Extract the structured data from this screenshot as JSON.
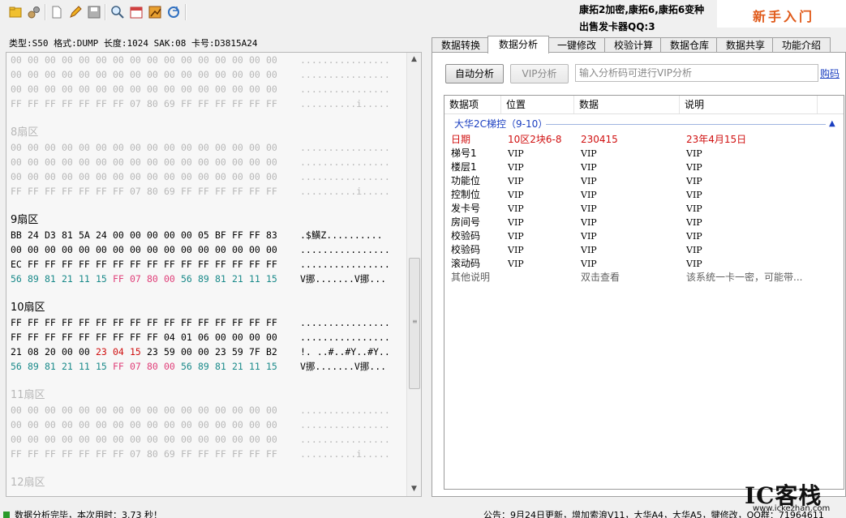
{
  "toolbar": {
    "icons": [
      "open-folder-icon",
      "settings-icon",
      "new-file-icon",
      "edit-pencil-icon",
      "save-disk-icon",
      "search-icon",
      "calendar-icon",
      "chart-icon",
      "refresh-icon"
    ]
  },
  "promo": {
    "line1": "康拓2加密,康拓6,康拓6变种",
    "line2": "出售发卡器QQ:3",
    "newbie": "新手入门"
  },
  "info_bar": "类型:S50 格式:DUMP 长度:1024 SAK:08 卡号:D3815A24",
  "hex": {
    "leading_rows": [
      {
        "bytes": [
          "00",
          "00",
          "00",
          "00",
          "00",
          "00",
          "00",
          "00",
          "00",
          "00",
          "00",
          "00",
          "00",
          "00",
          "00",
          "00"
        ],
        "ascii": "................",
        "style": "gray"
      },
      {
        "bytes": [
          "00",
          "00",
          "00",
          "00",
          "00",
          "00",
          "00",
          "00",
          "00",
          "00",
          "00",
          "00",
          "00",
          "00",
          "00",
          "00"
        ],
        "ascii": "................",
        "style": "gray"
      },
      {
        "bytes": [
          "00",
          "00",
          "00",
          "00",
          "00",
          "00",
          "00",
          "00",
          "00",
          "00",
          "00",
          "00",
          "00",
          "00",
          "00",
          "00"
        ],
        "ascii": "................",
        "style": "gray"
      },
      {
        "bytes": [
          "FF",
          "FF",
          "FF",
          "FF",
          "FF",
          "FF",
          "FF",
          "07",
          "80",
          "69",
          "FF",
          "FF",
          "FF",
          "FF",
          "FF",
          "FF"
        ],
        "ascii": "..........i.....",
        "style": "gray"
      }
    ],
    "sectors": [
      {
        "title": "8扇区",
        "dim": true,
        "rows": [
          {
            "bytes": [
              "00",
              "00",
              "00",
              "00",
              "00",
              "00",
              "00",
              "00",
              "00",
              "00",
              "00",
              "00",
              "00",
              "00",
              "00",
              "00"
            ],
            "ascii": "................",
            "style": "gray"
          },
          {
            "bytes": [
              "00",
              "00",
              "00",
              "00",
              "00",
              "00",
              "00",
              "00",
              "00",
              "00",
              "00",
              "00",
              "00",
              "00",
              "00",
              "00"
            ],
            "ascii": "................",
            "style": "gray"
          },
          {
            "bytes": [
              "00",
              "00",
              "00",
              "00",
              "00",
              "00",
              "00",
              "00",
              "00",
              "00",
              "00",
              "00",
              "00",
              "00",
              "00",
              "00"
            ],
            "ascii": "................",
            "style": "gray"
          },
          {
            "bytes": [
              "FF",
              "FF",
              "FF",
              "FF",
              "FF",
              "FF",
              "FF",
              "07",
              "80",
              "69",
              "FF",
              "FF",
              "FF",
              "FF",
              "FF",
              "FF"
            ],
            "ascii": "..........i.....",
            "style": "gray"
          }
        ]
      },
      {
        "title": "9扇区",
        "dim": false,
        "rows": [
          {
            "bytes": [
              "BB",
              "24",
              "D3",
              "81",
              "5A",
              "24",
              "00",
              "00",
              "00",
              "00",
              "00",
              "05",
              "BF",
              "FF",
              "FF",
              "83"
            ],
            "ascii": ".$鱑Z..........",
            "style": "black"
          },
          {
            "bytes": [
              "00",
              "00",
              "00",
              "00",
              "00",
              "00",
              "00",
              "00",
              "00",
              "00",
              "00",
              "00",
              "00",
              "00",
              "00",
              "00"
            ],
            "ascii": "................",
            "style": "black"
          },
          {
            "bytes": [
              "EC",
              "FF",
              "FF",
              "FF",
              "FF",
              "FF",
              "FF",
              "FF",
              "FF",
              "FF",
              "FF",
              "FF",
              "FF",
              "FF",
              "FF",
              "FF"
            ],
            "ascii": "................",
            "style": "black"
          },
          {
            "bytes": [
              "56",
              "89",
              "81",
              "21",
              "11",
              "15",
              "FF",
              "07",
              "80",
              "00",
              "56",
              "89",
              "81",
              "21",
              "11",
              "15"
            ],
            "ascii": "V挪.......V挪...",
            "style": "trailer"
          }
        ]
      },
      {
        "title": "10扇区",
        "dim": false,
        "rows": [
          {
            "bytes": [
              "FF",
              "FF",
              "FF",
              "FF",
              "FF",
              "FF",
              "FF",
              "FF",
              "FF",
              "FF",
              "FF",
              "FF",
              "FF",
              "FF",
              "FF",
              "FF"
            ],
            "ascii": "................",
            "style": "black"
          },
          {
            "bytes": [
              "FF",
              "FF",
              "FF",
              "FF",
              "FF",
              "FF",
              "FF",
              "FF",
              "FF",
              "04",
              "01",
              "06",
              "00",
              "00",
              "00",
              "00"
            ],
            "ascii": "................",
            "style": "black"
          },
          {
            "bytes": [
              "21",
              "08",
              "20",
              "00",
              "00",
              "23",
              "04",
              "15",
              "23",
              "59",
              "00",
              "00",
              "23",
              "59",
              "7F",
              "B2"
            ],
            "ascii": "!. ..#..#Y..#Y..",
            "style": "date"
          },
          {
            "bytes": [
              "56",
              "89",
              "81",
              "21",
              "11",
              "15",
              "FF",
              "07",
              "80",
              "00",
              "56",
              "89",
              "81",
              "21",
              "11",
              "15"
            ],
            "ascii": "V挪.......V挪...",
            "style": "trailer"
          }
        ]
      },
      {
        "title": "11扇区",
        "dim": true,
        "rows": [
          {
            "bytes": [
              "00",
              "00",
              "00",
              "00",
              "00",
              "00",
              "00",
              "00",
              "00",
              "00",
              "00",
              "00",
              "00",
              "00",
              "00",
              "00"
            ],
            "ascii": "................",
            "style": "gray"
          },
          {
            "bytes": [
              "00",
              "00",
              "00",
              "00",
              "00",
              "00",
              "00",
              "00",
              "00",
              "00",
              "00",
              "00",
              "00",
              "00",
              "00",
              "00"
            ],
            "ascii": "................",
            "style": "gray"
          },
          {
            "bytes": [
              "00",
              "00",
              "00",
              "00",
              "00",
              "00",
              "00",
              "00",
              "00",
              "00",
              "00",
              "00",
              "00",
              "00",
              "00",
              "00"
            ],
            "ascii": "................",
            "style": "gray"
          },
          {
            "bytes": [
              "FF",
              "FF",
              "FF",
              "FF",
              "FF",
              "FF",
              "FF",
              "07",
              "80",
              "69",
              "FF",
              "FF",
              "FF",
              "FF",
              "FF",
              "FF"
            ],
            "ascii": "..........i.....",
            "style": "gray"
          }
        ]
      },
      {
        "title": "12扇区",
        "dim": true,
        "rows": []
      }
    ]
  },
  "tabs": [
    {
      "label": "数据转换",
      "active": false
    },
    {
      "label": "数据分析",
      "active": true
    },
    {
      "label": "一键修改",
      "active": false
    },
    {
      "label": "校验计算",
      "active": false
    },
    {
      "label": "数据仓库",
      "active": false
    },
    {
      "label": "数据共享",
      "active": false
    },
    {
      "label": "功能介绍",
      "active": false
    }
  ],
  "analysis": {
    "auto_btn": "自动分析",
    "vip_btn": "VIP分析",
    "vip_placeholder": "输入分析码可进行VIP分析",
    "buy_link": "购码",
    "columns": [
      "数据项",
      "位置",
      "数据",
      "说明"
    ],
    "group": "大华2C梯控（9-10）",
    "rows": [
      {
        "item": "日期",
        "pos": "10区2块6-8",
        "data": "230415",
        "desc": "23年4月15日",
        "style": "hl"
      },
      {
        "item": "梯号1",
        "pos": "VIP",
        "data": "VIP",
        "desc": "VIP",
        "style": ""
      },
      {
        "item": "楼层1",
        "pos": "VIP",
        "data": "VIP",
        "desc": "VIP",
        "style": ""
      },
      {
        "item": "功能位",
        "pos": "VIP",
        "data": "VIP",
        "desc": "VIP",
        "style": ""
      },
      {
        "item": "控制位",
        "pos": "VIP",
        "data": "VIP",
        "desc": "VIP",
        "style": ""
      },
      {
        "item": "发卡号",
        "pos": "VIP",
        "data": "VIP",
        "desc": "VIP",
        "style": ""
      },
      {
        "item": "房间号",
        "pos": "VIP",
        "data": "VIP",
        "desc": "VIP",
        "style": ""
      },
      {
        "item": "校验码",
        "pos": "VIP",
        "data": "VIP",
        "desc": "VIP",
        "style": ""
      },
      {
        "item": "校验码",
        "pos": "VIP",
        "data": "VIP",
        "desc": "VIP",
        "style": ""
      },
      {
        "item": "滚动码",
        "pos": "VIP",
        "data": "VIP",
        "desc": "VIP",
        "style": ""
      },
      {
        "item": "其他说明",
        "pos": "",
        "data": "双击查看",
        "desc": "该系统一卡一密，可能带...",
        "style": "muted"
      }
    ]
  },
  "watermark": {
    "logo": "IC客栈",
    "url": "www.ickezhan.com"
  },
  "status": {
    "left": "数据分析完毕，本次用时：3.73 秒！",
    "right": "公告：9月24日更新，增加索浪V11，大华A4，大华A5，犍修改，QQ群：71964611"
  }
}
